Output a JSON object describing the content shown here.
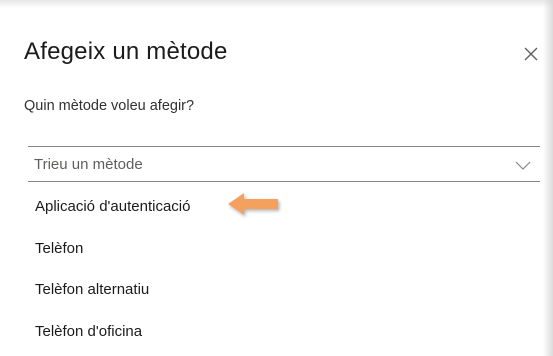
{
  "dialog": {
    "title": "Afegeix un mètode",
    "subtitle": "Quin mètode voleu afegir?",
    "close_icon": "close-icon"
  },
  "select": {
    "value": "Trieu un mètode",
    "icon": "chevron-down-icon"
  },
  "options": [
    {
      "label": "Aplicació d'autenticació"
    },
    {
      "label": "Telèfon"
    },
    {
      "label": "Telèfon alternatiu"
    },
    {
      "label": "Telèfon d'oficina"
    }
  ],
  "annotation": {
    "icon": "arrow-left-icon",
    "color": "#f4a15d"
  },
  "colors": {
    "text": "#1b1b1b",
    "muted": "#605e5c",
    "border": "#8a8886"
  }
}
